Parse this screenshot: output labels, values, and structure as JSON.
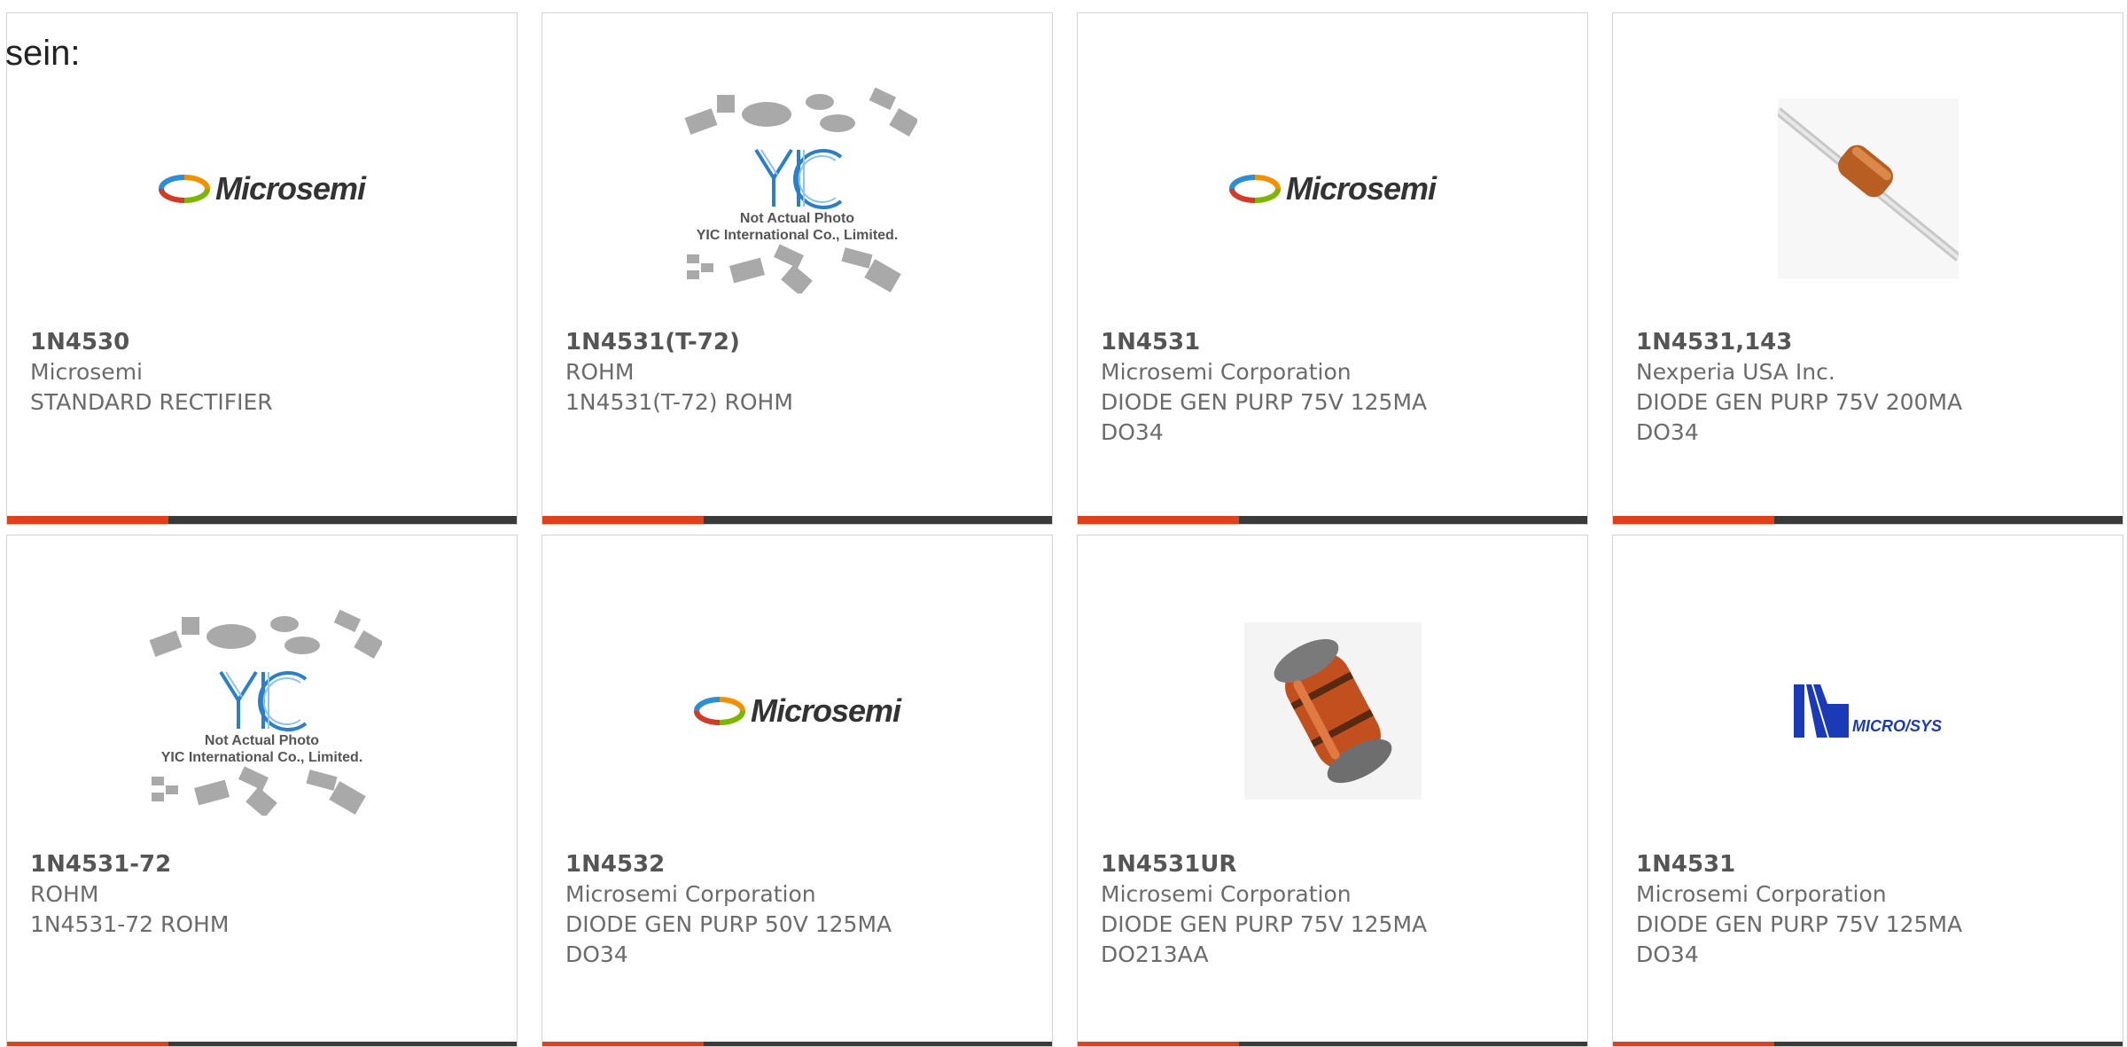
{
  "intro": "sein:",
  "colors": {
    "accent": "#e0401a",
    "bar": "#3a3a3a",
    "microsys": "#1a3ab8"
  },
  "cards": [
    {
      "part": "1N4530",
      "manufacturer": "Microsemi",
      "desc": [
        "STANDARD RECTIFIER"
      ],
      "image": "microsemi-logo"
    },
    {
      "part": "1N4531(T-72)",
      "manufacturer": "ROHM",
      "desc": [
        "1N4531(T-72) ROHM"
      ],
      "image": "yic-not-actual-photo"
    },
    {
      "part": "1N4531",
      "manufacturer": "Microsemi Corporation",
      "desc": [
        "DIODE GEN PURP 75V 125MA",
        "DO34"
      ],
      "image": "microsemi-logo"
    },
    {
      "part": "1N4531,143",
      "manufacturer": "Nexperia USA Inc.",
      "desc": [
        "DIODE GEN PURP 75V 200MA",
        "DO34"
      ],
      "image": "axial-diode-photo"
    },
    {
      "part": "1N4531-72",
      "manufacturer": "ROHM",
      "desc": [
        "1N4531-72 ROHM"
      ],
      "image": "yic-not-actual-photo"
    },
    {
      "part": "1N4532",
      "manufacturer": "Microsemi Corporation",
      "desc": [
        "DIODE GEN PURP 50V 125MA",
        "DO34"
      ],
      "image": "microsemi-logo"
    },
    {
      "part": "1N4531UR",
      "manufacturer": "Microsemi Corporation",
      "desc": [
        "DIODE GEN PURP 75V 125MA",
        "DO213AA"
      ],
      "image": "melf-diode-photo"
    },
    {
      "part": "1N4531",
      "manufacturer": "Microsemi Corporation",
      "desc": [
        "DIODE GEN PURP 75V 125MA",
        "DO34"
      ],
      "image": "microsys-logo"
    }
  ],
  "logos": {
    "microsemi": "Microsemi",
    "yic_line1": "Not Actual Photo",
    "yic_line2": "YIC International Co., Limited.",
    "yic_mark": "YIC",
    "microsys": "MICRO/SYS"
  }
}
